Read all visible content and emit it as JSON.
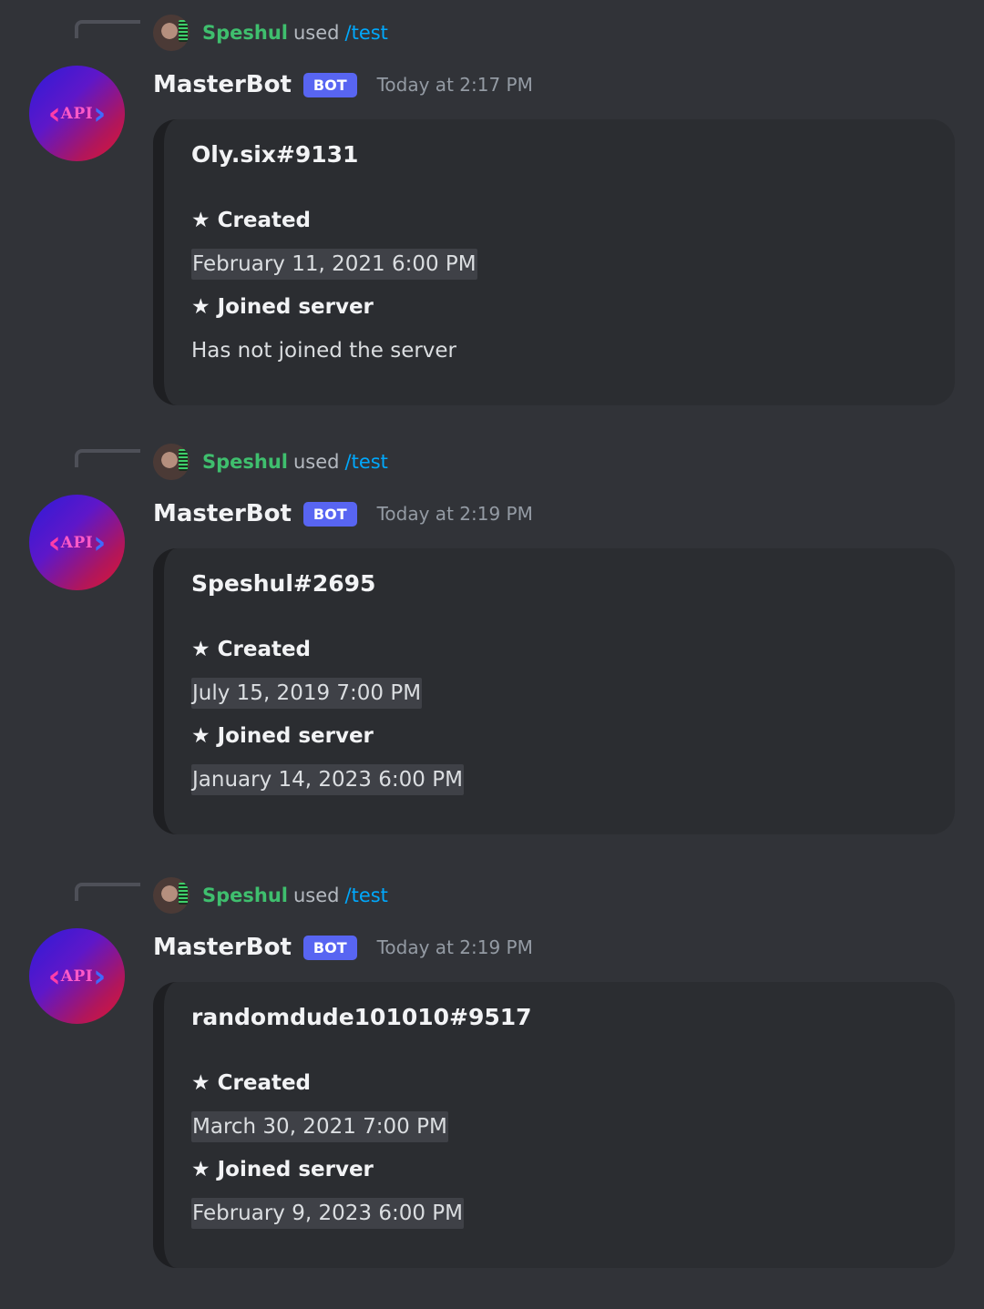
{
  "messages": [
    {
      "reply": {
        "user": "Speshul",
        "used": "used",
        "command": "/test"
      },
      "author": "MasterBot",
      "tag": "BOT",
      "timestamp": "Today at 2:17 PM",
      "avatar_text": "API",
      "embed": {
        "title": "Oly.six#9131",
        "fields": [
          {
            "name": "★ Created",
            "value": "February 11, 2021 6:00 PM",
            "is_timestamp": true
          },
          {
            "name": "★ Joined server",
            "value": "Has not joined the server",
            "is_timestamp": false
          }
        ]
      }
    },
    {
      "reply": {
        "user": "Speshul",
        "used": "used",
        "command": "/test"
      },
      "author": "MasterBot",
      "tag": "BOT",
      "timestamp": "Today at 2:19 PM",
      "avatar_text": "API",
      "embed": {
        "title": "Speshul#2695",
        "fields": [
          {
            "name": "★ Created",
            "value": "July 15, 2019 7:00 PM",
            "is_timestamp": true
          },
          {
            "name": "★ Joined server",
            "value": "January 14, 2023 6:00 PM",
            "is_timestamp": true
          }
        ]
      }
    },
    {
      "reply": {
        "user": "Speshul",
        "used": "used",
        "command": "/test"
      },
      "author": "MasterBot",
      "tag": "BOT",
      "timestamp": "Today at 2:19 PM",
      "avatar_text": "API",
      "embed": {
        "title": "randomdude101010#9517",
        "fields": [
          {
            "name": "★ Created",
            "value": "March 30, 2021 7:00 PM",
            "is_timestamp": true
          },
          {
            "name": "★ Joined server",
            "value": "February 9, 2023 6:00 PM",
            "is_timestamp": true
          }
        ]
      }
    }
  ],
  "colors": {
    "background": "#313338",
    "embed_background": "#2b2d31",
    "reply_user": "#3fbf6e",
    "command": "#00a8fc",
    "bot_tag": "#5865f2"
  }
}
